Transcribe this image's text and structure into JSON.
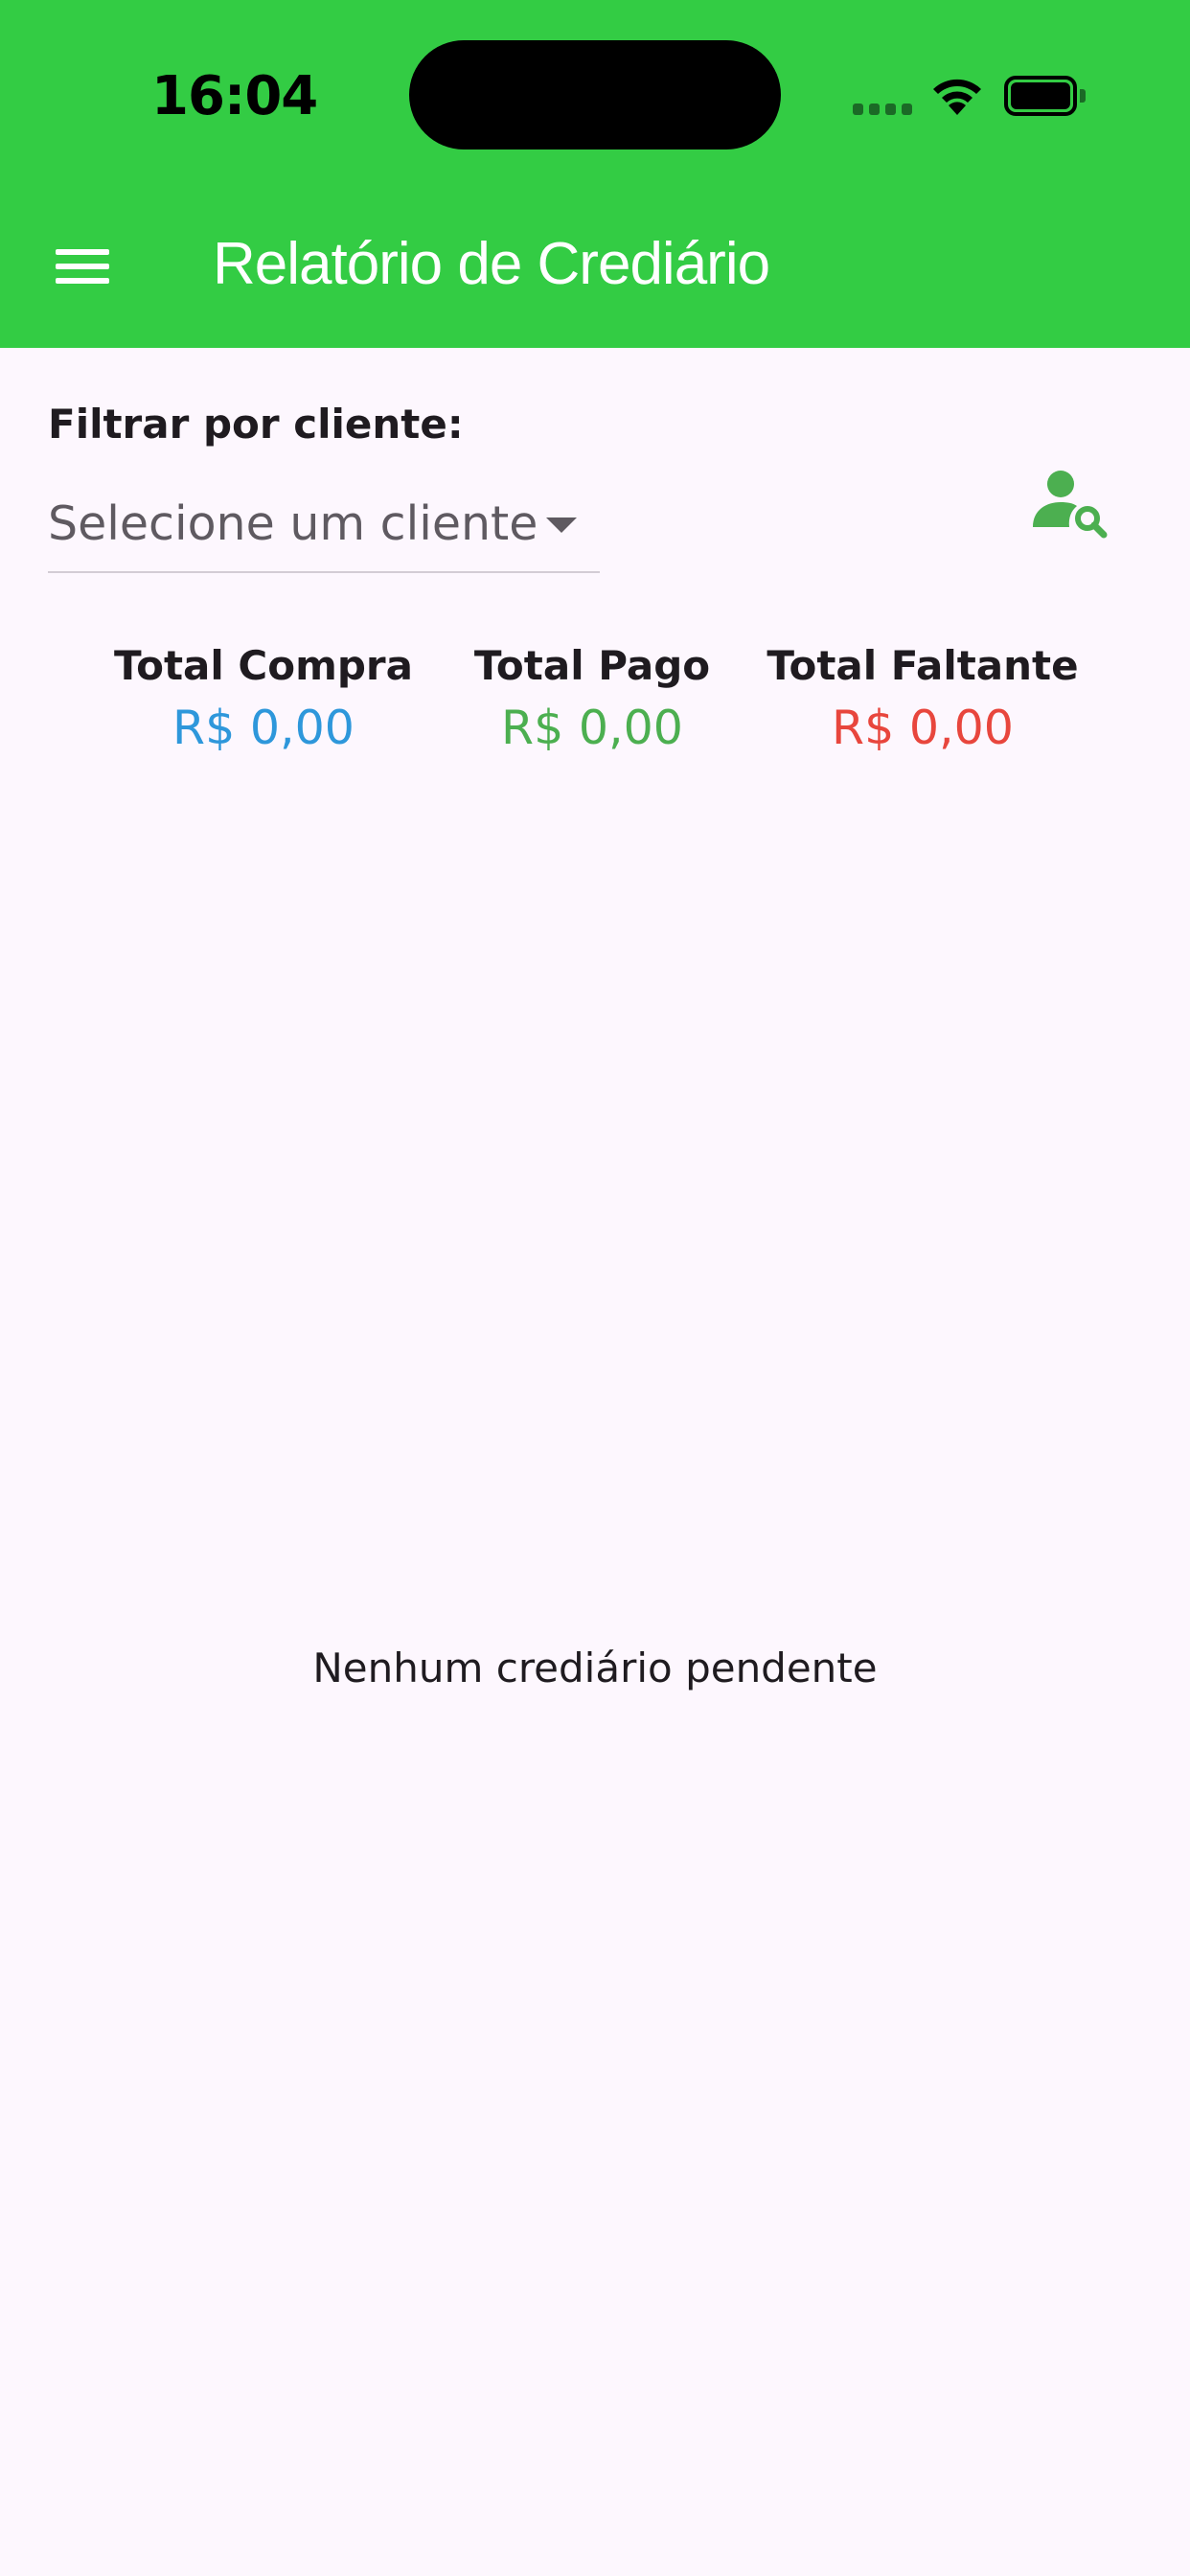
{
  "status_bar": {
    "time": "16:04"
  },
  "app_bar": {
    "title": "Relatório de Crediário",
    "menu_icon": "hamburger-menu-icon",
    "background_color": "#33cc44"
  },
  "filter": {
    "label": "Filtrar por cliente:",
    "dropdown_placeholder": "Selecione um cliente",
    "dropdown_icon": "chevron-down-icon",
    "search_icon": "person-search-icon",
    "search_icon_color": "#4caf50"
  },
  "totals": [
    {
      "label": "Total Compra",
      "value": "R$ 0,00",
      "color": "#2e97db"
    },
    {
      "label": "Total Pago",
      "value": "R$ 0,00",
      "color": "#4caf50"
    },
    {
      "label": "Total Faltante",
      "value": "R$ 0,00",
      "color": "#e8463d"
    }
  ],
  "empty_state": {
    "message": "Nenhum crediário pendente"
  }
}
